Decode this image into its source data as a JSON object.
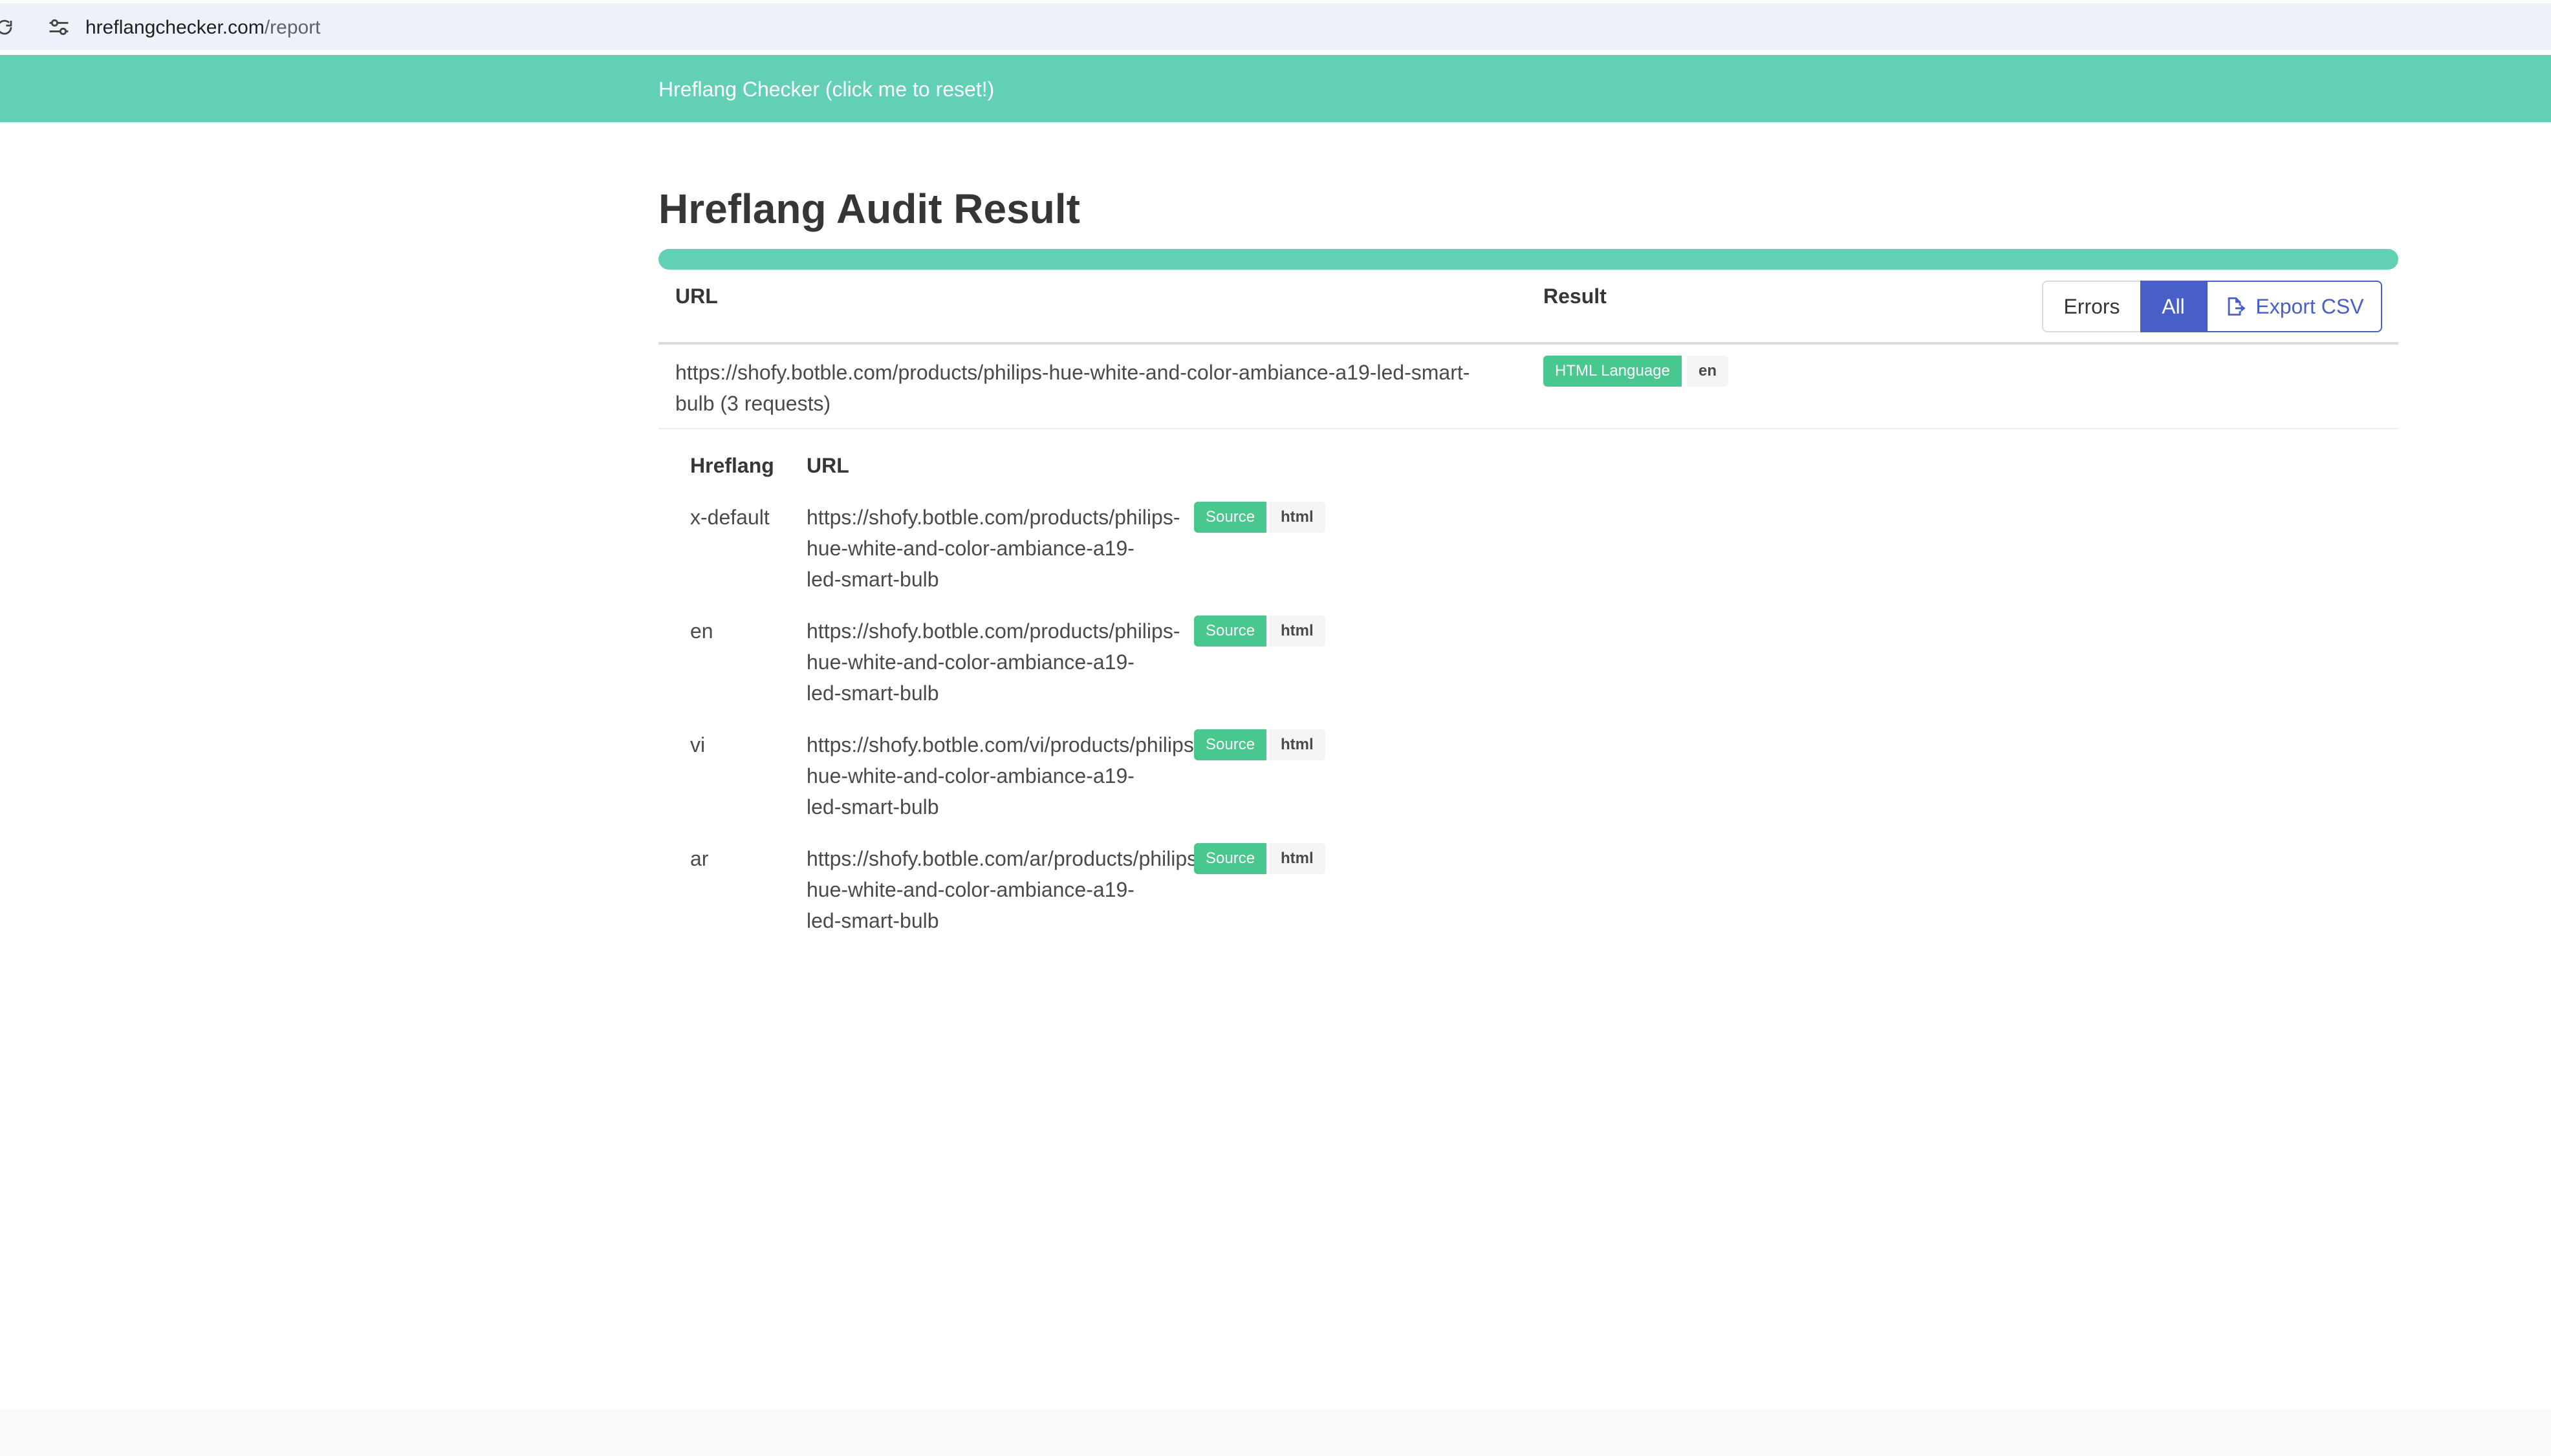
{
  "browser": {
    "domain": "hreflangchecker.com",
    "path": "/report"
  },
  "banner": {
    "title": "Hreflang Checker (click me to reset!)"
  },
  "page": {
    "title": "Hreflang Audit Result",
    "progress_percent": 100
  },
  "table": {
    "col_url": "URL",
    "col_result": "Result",
    "filter_buttons": {
      "errors": "Errors",
      "all": "All",
      "export": "Export CSV"
    },
    "row": {
      "url": "https://shofy.botble.com/products/philips-hue-white-and-color-ambiance-a19-led-smart-bulb (3 requests)",
      "result_label": "HTML Language",
      "result_value": "en"
    }
  },
  "hreflang_table": {
    "col_hreflang": "Hreflang",
    "col_url": "URL",
    "rows": [
      {
        "hreflang": "x-default",
        "url_lines": [
          "https://shofy.botble.com/products/philips-",
          "hue-white-and-color-ambiance-a19-",
          "led-smart-bulb"
        ],
        "source_label": "Source",
        "source_value": "html"
      },
      {
        "hreflang": "en",
        "url_lines": [
          "https://shofy.botble.com/products/philips-",
          "hue-white-and-color-ambiance-a19-",
          "led-smart-bulb"
        ],
        "source_label": "Source",
        "source_value": "html"
      },
      {
        "hreflang": "vi",
        "url_lines": [
          "https://shofy.botble.com/vi/products/philips-",
          "hue-white-and-color-ambiance-a19-",
          "led-smart-bulb"
        ],
        "source_label": "Source",
        "source_value": "html"
      },
      {
        "hreflang": "ar",
        "url_lines": [
          "https://shofy.botble.com/ar/products/philips-",
          "hue-white-and-color-ambiance-a19-",
          "led-smart-bulb"
        ],
        "source_label": "Source",
        "source_value": "html"
      }
    ]
  },
  "colors": {
    "brand_teal": "#62d0b5",
    "tag_green": "#48c78e",
    "primary_blue": "#485fc7"
  }
}
